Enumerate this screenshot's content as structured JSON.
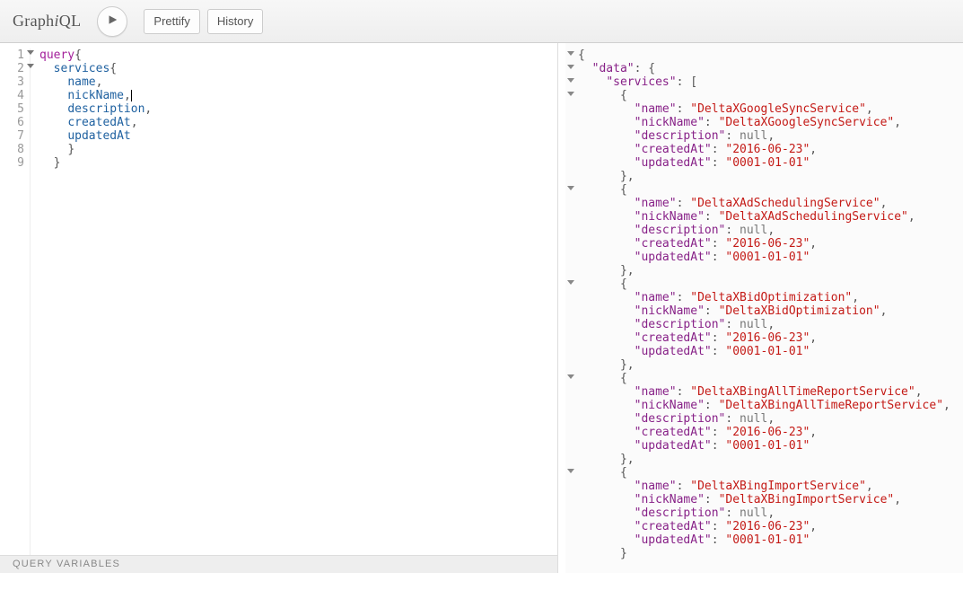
{
  "header": {
    "logo_parts": [
      "Graph",
      "i",
      "QL"
    ],
    "prettify_label": "Prettify",
    "history_label": "History"
  },
  "query": {
    "lines": [
      {
        "n": 1,
        "fold": true,
        "tokens": [
          {
            "t": "kw",
            "v": "query"
          },
          {
            "t": "punc",
            "v": "{"
          }
        ]
      },
      {
        "n": 2,
        "fold": true,
        "tokens": [
          {
            "t": "txt",
            "v": "  "
          },
          {
            "t": "prop",
            "v": "services"
          },
          {
            "t": "punc",
            "v": "{"
          }
        ]
      },
      {
        "n": 3,
        "tokens": [
          {
            "t": "txt",
            "v": "    "
          },
          {
            "t": "prop",
            "v": "name"
          },
          {
            "t": "punc",
            "v": ","
          }
        ]
      },
      {
        "n": 4,
        "tokens": [
          {
            "t": "txt",
            "v": "    "
          },
          {
            "t": "prop",
            "v": "nickName"
          },
          {
            "t": "punc",
            "v": ","
          },
          {
            "t": "cursor"
          }
        ]
      },
      {
        "n": 5,
        "tokens": [
          {
            "t": "txt",
            "v": "    "
          },
          {
            "t": "prop",
            "v": "description"
          },
          {
            "t": "punc",
            "v": ","
          }
        ]
      },
      {
        "n": 6,
        "tokens": [
          {
            "t": "txt",
            "v": "    "
          },
          {
            "t": "prop",
            "v": "createdAt"
          },
          {
            "t": "punc",
            "v": ","
          }
        ]
      },
      {
        "n": 7,
        "tokens": [
          {
            "t": "txt",
            "v": "    "
          },
          {
            "t": "prop",
            "v": "updatedAt"
          }
        ]
      },
      {
        "n": 8,
        "tokens": [
          {
            "t": "txt",
            "v": "    "
          },
          {
            "t": "punc",
            "v": "}"
          }
        ]
      },
      {
        "n": 9,
        "tokens": [
          {
            "t": "txt",
            "v": "  "
          },
          {
            "t": "punc",
            "v": "}"
          }
        ]
      }
    ],
    "vars_label": "Query Variables"
  },
  "result": {
    "data_key": "data",
    "services_key": "services",
    "services": [
      {
        "name": "DeltaXGoogleSyncService",
        "nickName": "DeltaXGoogleSyncService",
        "description": null,
        "createdAt": "2016-06-23",
        "updatedAt": "0001-01-01"
      },
      {
        "name": "DeltaXAdSchedulingService",
        "nickName": "DeltaXAdSchedulingService",
        "description": null,
        "createdAt": "2016-06-23",
        "updatedAt": "0001-01-01"
      },
      {
        "name": "DeltaXBidOptimization",
        "nickName": "DeltaXBidOptimization",
        "description": null,
        "createdAt": "2016-06-23",
        "updatedAt": "0001-01-01"
      },
      {
        "name": "DeltaXBingAllTimeReportService",
        "nickName": "DeltaXBingAllTimeReportService",
        "description": null,
        "createdAt": "2016-06-23",
        "updatedAt": "0001-01-01"
      },
      {
        "name": "DeltaXBingImportService",
        "nickName": "DeltaXBingImportService",
        "description": null,
        "createdAt": "2016-06-23",
        "updatedAt": "0001-01-01"
      }
    ],
    "field_keys": [
      "name",
      "nickName",
      "description",
      "createdAt",
      "updatedAt"
    ]
  }
}
